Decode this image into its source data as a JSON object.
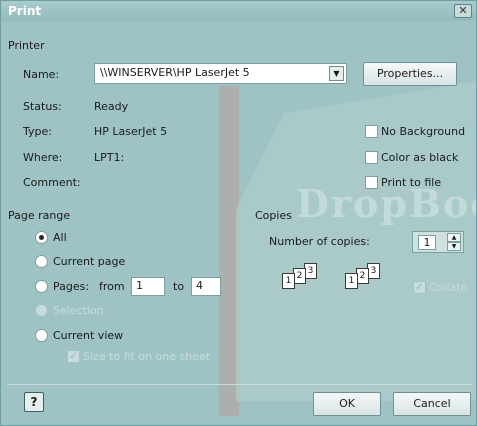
{
  "window": {
    "title": "Print",
    "close_glyph": "✕"
  },
  "printer": {
    "section": "Printer",
    "name_label": "Name:",
    "name_value": "\\\\WINSERVER\\HP LaserJet 5",
    "properties_label": "Properties...",
    "status_label": "Status:",
    "status_value": "Ready",
    "type_label": "Type:",
    "type_value": "HP LaserJet 5",
    "where_label": "Where:",
    "where_value": "LPT1:",
    "comment_label": "Comment:",
    "options": [
      {
        "label": "No Background",
        "checked": false
      },
      {
        "label": "Color as black",
        "checked": false
      },
      {
        "label": "Print to file",
        "checked": false
      }
    ]
  },
  "page_range": {
    "section": "Page range",
    "all_label": "All",
    "current_page_label": "Current page",
    "pages_label": "Pages:",
    "from_label": "from",
    "from_value": "1",
    "to_label": "to",
    "to_value": "4",
    "selection_label": "Selection",
    "current_view_label": "Current view",
    "fit_label": "Size to fit on one sheet",
    "selected": "All"
  },
  "copies": {
    "section": "Copies",
    "number_label": "Number of copies:",
    "number_value": "1",
    "collate_label": "Collate",
    "collate_checked": true,
    "page_numbers": [
      "1",
      "2",
      "3"
    ]
  },
  "footer": {
    "help_glyph": "?",
    "ok_label": "OK",
    "cancel_label": "Cancel"
  },
  "colors": {
    "dialog_bg": "#9fc3c4",
    "title_text": "#ffffff"
  }
}
